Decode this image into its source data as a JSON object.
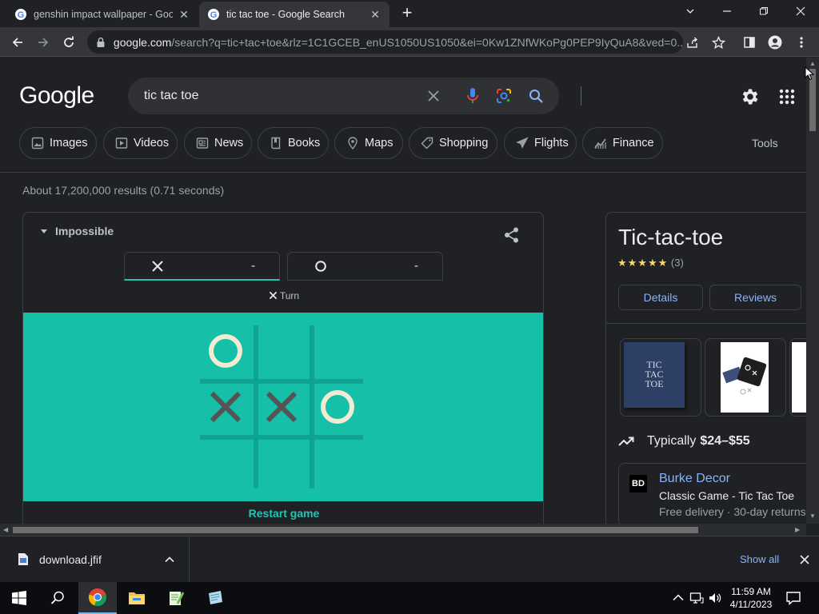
{
  "browser": {
    "tabs": [
      {
        "title": "genshin impact wallpaper - Google",
        "active": false
      },
      {
        "title": "tic tac toe - Google Search",
        "active": true
      }
    ],
    "url_host": "google.com",
    "url_path": "/search?q=tic+tac+toe&rlz=1C1GCEB_enUS1050US1050&ei=0Kw1ZNfWKoPg0PEP9IyQuA8&ved=0..."
  },
  "search": {
    "logo": "Google",
    "query": "tic tac toe"
  },
  "chips": [
    {
      "label": "Images",
      "icon": "image-icon"
    },
    {
      "label": "Videos",
      "icon": "video-icon"
    },
    {
      "label": "News",
      "icon": "news-icon"
    },
    {
      "label": "Books",
      "icon": "book-icon"
    },
    {
      "label": "Maps",
      "icon": "map-pin-icon"
    },
    {
      "label": "Shopping",
      "icon": "tag-icon"
    },
    {
      "label": "Flights",
      "icon": "airplane-icon"
    },
    {
      "label": "Finance",
      "icon": "finance-icon"
    }
  ],
  "tools_label": "Tools",
  "result_stats": "About 17,200,000 results (0.71 seconds)",
  "game": {
    "difficulty": "Impossible",
    "score_x": "-",
    "score_o": "-",
    "turn_label": "Turn",
    "board": [
      "O",
      "",
      "",
      "X",
      "X",
      "O",
      "",
      "",
      ""
    ],
    "restart_label": "Restart game",
    "colors": {
      "board_bg": "#16bfa8",
      "grid": "#0fa393",
      "x_mark": "#545454",
      "o_mark": "#f2ebd3"
    }
  },
  "knowledge_panel": {
    "title": "Tic-tac-toe",
    "stars": "★★★★★",
    "review_count": "(3)",
    "tabs": [
      "Details",
      "Reviews"
    ],
    "image_box_text": [
      "TIC",
      "TAC",
      "TOE"
    ],
    "price_prefix": "Typically",
    "price_range": "$24–$55",
    "seller": {
      "logo": "BD",
      "name": "Burke Decor",
      "product": "Classic Game - Tic Tac Toe",
      "delivery": "Free delivery · 30-day returns"
    }
  },
  "downloads": {
    "file_name": "download.jfif",
    "show_all": "Show all"
  },
  "taskbar": {
    "time": "11:59 AM",
    "date": "4/11/2023"
  }
}
